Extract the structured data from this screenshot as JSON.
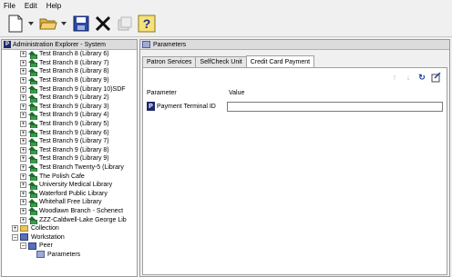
{
  "menu": [
    "File",
    "Edit",
    "Help"
  ],
  "toolbar": {
    "icons": [
      "new-document-icon",
      "open-folder-icon",
      "save-disk-icon",
      "delete-x-icon",
      "properties-icon",
      "help-icon"
    ]
  },
  "left_pane": {
    "title": "Administration Explorer - System",
    "tree": [
      {
        "label": "Test Branch 8 (Library 6)",
        "type": "branch"
      },
      {
        "label": "Test Branch 8 (Library 7)",
        "type": "branch"
      },
      {
        "label": "Test Branch 8 (Library 8)",
        "type": "branch"
      },
      {
        "label": "Test Branch 8 (Library 9)",
        "type": "branch"
      },
      {
        "label": "Test Branch 9 (Library 10)SDF",
        "type": "branch"
      },
      {
        "label": "Test Branch 9 (Library 2)",
        "type": "branch"
      },
      {
        "label": "Test Branch 9 (Library 3)",
        "type": "branch"
      },
      {
        "label": "Test Branch 9 (Library 4)",
        "type": "branch"
      },
      {
        "label": "Test Branch 9 (Library 5)",
        "type": "branch"
      },
      {
        "label": "Test Branch 9 (Library 6)",
        "type": "branch"
      },
      {
        "label": "Test Branch 9 (Library 7)",
        "type": "branch"
      },
      {
        "label": "Test Branch 9 (Library 8)",
        "type": "branch"
      },
      {
        "label": "Test Branch 9 (Library 9)",
        "type": "branch"
      },
      {
        "label": "Test Branch Twenty-5 (Library",
        "type": "branch"
      },
      {
        "label": "The Polish Cafe",
        "type": "branch"
      },
      {
        "label": "University Medical Library",
        "type": "branch"
      },
      {
        "label": "Waterford Public Library",
        "type": "branch"
      },
      {
        "label": "Whitehall Free Library",
        "type": "branch"
      },
      {
        "label": "Woodlawn Branch - Schenect",
        "type": "branch"
      },
      {
        "label": "ZZZ-Caldwell-Lake George Lib",
        "type": "branch"
      },
      {
        "label": "Collection",
        "type": "folder"
      },
      {
        "label": "Workstation",
        "type": "workstation"
      },
      {
        "label": "Peer",
        "type": "peer"
      },
      {
        "label": "Parameters",
        "type": "parameters"
      }
    ]
  },
  "right_pane": {
    "title": "Parameters",
    "tabs": [
      "Patron Services",
      "SelfCheck Unit",
      "Credit Card Payment"
    ],
    "active_tab": "Credit Card Payment",
    "columns": [
      "Parameter",
      "Value"
    ],
    "rows": [
      {
        "name": "Payment Terminal ID",
        "value": ""
      }
    ]
  }
}
